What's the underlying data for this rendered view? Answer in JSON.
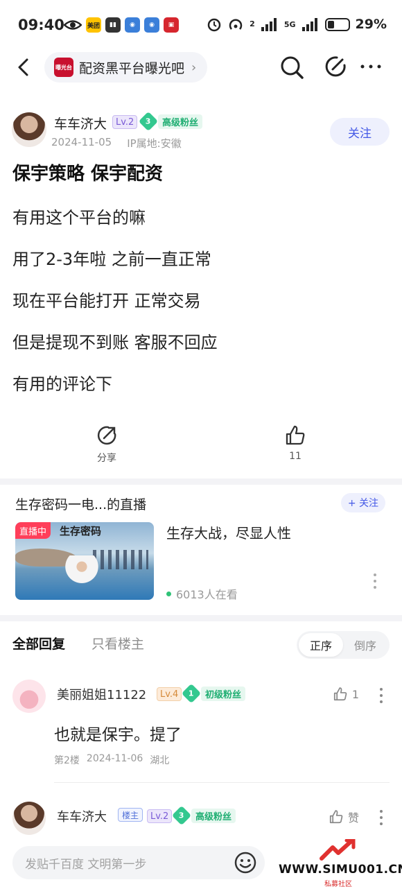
{
  "status_bar": {
    "time": "09:40",
    "app_icon_meituan": "美团",
    "battery_percent": "29%",
    "signal_1": "2",
    "signal_2": "5G",
    "signal_3": "5G"
  },
  "nav": {
    "forum_name": "配资黑平台曝光吧",
    "forum_logo_text": "曝光台"
  },
  "post": {
    "author": "车车济大",
    "level": "Lv.2",
    "fan_level": "3",
    "fan_title": "高级粉丝",
    "date": "2024-11-05",
    "ip": "IP属地:安徽",
    "follow_label": "关注",
    "title": "保宇策略 保宇配资",
    "lines": [
      "有用这个平台的嘛",
      "用了2-3年啦 之前一直正常",
      "现在平台能打开 正常交易",
      "但是提现不到账 客服不回应",
      "有用的评论下"
    ],
    "share_label": "分享",
    "like_count": "11"
  },
  "live": {
    "title": "生存密码一电...的直播",
    "follow_label": "+ 关注",
    "badge": "直播中",
    "brand": "生存密码",
    "headline": "生存大战，尽显人性",
    "viewers": "6013人在看"
  },
  "replies": {
    "tab_all": "全部回复",
    "tab_op": "只看楼主",
    "sort_asc": "正序",
    "sort_desc": "倒序",
    "items": [
      {
        "name": "美丽姐姐11122",
        "level": "Lv.4",
        "fan_level": "1",
        "fan_title": "初级粉丝",
        "likes": "1",
        "text": "也就是保宇。提了",
        "floor": "第2楼",
        "date": "2024-11-06",
        "location": "湖北"
      },
      {
        "name": "车车济大",
        "op_tag": "楼主",
        "level": "Lv.2",
        "fan_level": "3",
        "fan_title": "高级粉丝",
        "likes": "赞"
      }
    ]
  },
  "bottom": {
    "reply_placeholder": "发贴千百度 文明第一步",
    "watermark_site": "WWW.SIMU001.CN",
    "watermark_sub": "私募社区"
  },
  "colors": {
    "accent": "#4459e6",
    "fan_green": "#1fae72",
    "live_red": "#ff3f5a"
  }
}
